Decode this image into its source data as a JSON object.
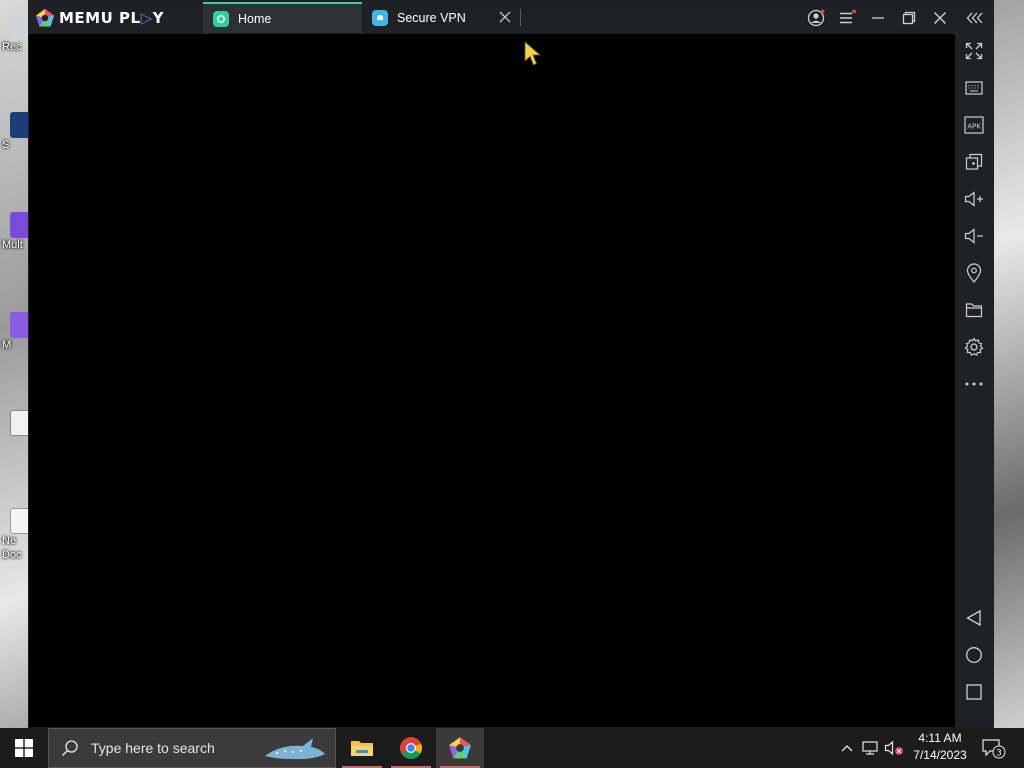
{
  "app": {
    "logo_text_1": "MEMU PL",
    "logo_text_2": "Y"
  },
  "tabs": [
    {
      "label": "Home",
      "icon": "home-app-icon",
      "active": true
    },
    {
      "label": "Secure VPN",
      "icon": "secure-vpn-app-icon",
      "active": false
    }
  ],
  "title_buttons": [
    "account-icon",
    "menu-icon",
    "minimize-icon",
    "restore-icon",
    "close-icon",
    "collapse-sidebar-icon"
  ],
  "sidebar_top": [
    "fullscreen-icon",
    "keyboard-icon",
    "apk-icon",
    "multi-window-icon",
    "volume-up-icon",
    "volume-down-icon",
    "location-icon",
    "folder-icon",
    "settings-icon",
    "more-icon"
  ],
  "sidebar_bottom": [
    "back-icon",
    "home-nav-icon",
    "recents-icon"
  ],
  "sidebar_apk_label": "APK",
  "desktop_icons": [
    "Rec",
    "S",
    "Mult",
    "M",
    "Ne Doc"
  ],
  "taskbar": {
    "search_placeholder": "Type here to search",
    "apps": [
      "file-explorer-icon",
      "chrome-icon",
      "memu-icon"
    ],
    "time": "4:11 AM",
    "date": "7/14/2023",
    "notification_count": "3"
  },
  "colors": {
    "accent": "#3ec8a8",
    "titlebar": "#1f2125",
    "tab_active": "#2d3035",
    "screen": "#000000"
  }
}
